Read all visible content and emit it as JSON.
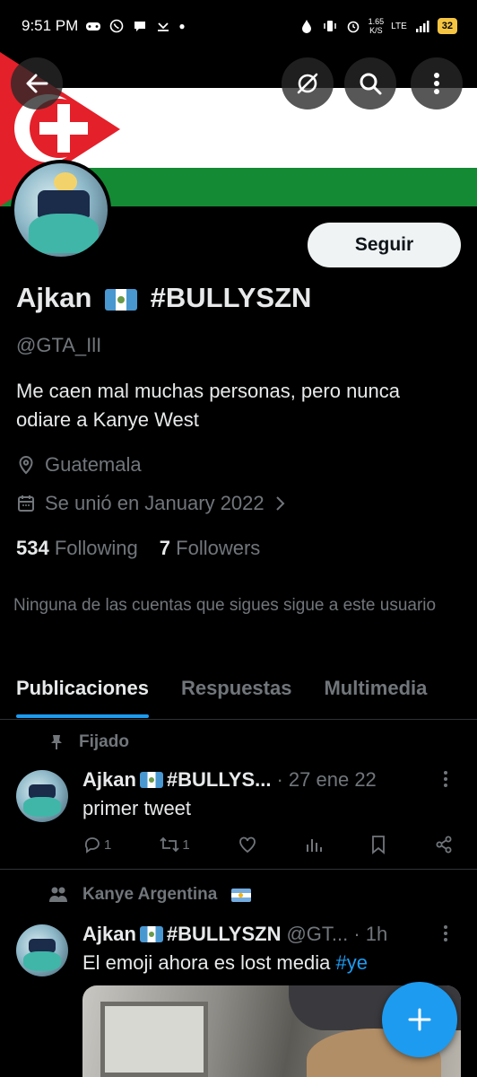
{
  "status_bar": {
    "time": "9:51 PM",
    "network_speed_value": "1.65",
    "network_speed_unit": "K/S",
    "network_type": "LTE",
    "battery": "32"
  },
  "header": {
    "back_icon": "arrow-left-icon",
    "grok_icon": "grok-icon",
    "search_icon": "search-icon",
    "more_icon": "more-vertical-icon"
  },
  "profile": {
    "name": "Ajkan",
    "name_suffix": "#BULLYSZN",
    "handle": "@GTA_IlI",
    "follow_label": "Seguir",
    "bio": "Me caen mal muchas personas, pero nunca odiare a Kanye West",
    "location": "Guatemala",
    "joined": "Se unió en January 2022",
    "following_count": "534",
    "following_label": "Following",
    "followers_count": "7",
    "followers_label": "Followers",
    "mutuals_note": "Ninguna de las cuentas que sigues sigue a este usuario"
  },
  "tabs": [
    {
      "label": "Publicaciones",
      "active": true
    },
    {
      "label": "Respuestas",
      "active": false
    },
    {
      "label": "Multimedia",
      "active": false
    }
  ],
  "posts": [
    {
      "context": "Fijado",
      "name": "Ajkan",
      "name_suffix": "#BULLYS...",
      "meta": "· 27 ene 22",
      "text": "primer tweet",
      "replies": "1",
      "reposts": "1",
      "likes": "",
      "views": ""
    },
    {
      "context": "Kanye Argentina",
      "name": "Ajkan",
      "name_suffix": "#BULLYSZN",
      "meta": "@GT... · 1h",
      "text": "El emoji ahora es lost media",
      "hashtag": "#ye"
    }
  ],
  "fab": {
    "label": "+",
    "icon": "compose-plus-icon"
  },
  "colors": {
    "accent": "#1d9bf0",
    "background": "#000000",
    "secondary_text": "#71767b"
  }
}
